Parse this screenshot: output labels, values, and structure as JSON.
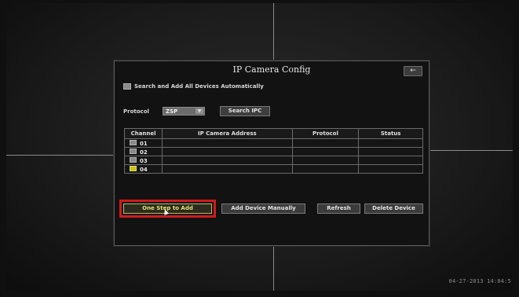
{
  "screen": {
    "timestamp": "04-27-2013 14:04:5"
  },
  "dialog": {
    "title": "IP Camera Config",
    "back_icon": "arrow-left-icon",
    "auto_search_label": "Search and Add All Devices Automatically",
    "protocol_label": "Protocol",
    "protocol_value": "ZSP",
    "search_button": "Search IPC",
    "table": {
      "headers": [
        "Channel",
        "IP Camera Address",
        "Protocol",
        "Status"
      ],
      "rows": [
        {
          "channel": "01",
          "address": "",
          "protocol": "",
          "status": ""
        },
        {
          "channel": "02",
          "address": "",
          "protocol": "",
          "status": ""
        },
        {
          "channel": "03",
          "address": "",
          "protocol": "",
          "status": ""
        },
        {
          "channel": "04",
          "address": "",
          "protocol": "",
          "status": ""
        }
      ]
    },
    "buttons": {
      "one_step": "One Step to Add",
      "add_manual": "Add Device Manually",
      "refresh": "Refresh",
      "delete": "Delete Device"
    }
  },
  "colors": {
    "highlight": "#d01b1b",
    "checked": "#c9c322"
  }
}
